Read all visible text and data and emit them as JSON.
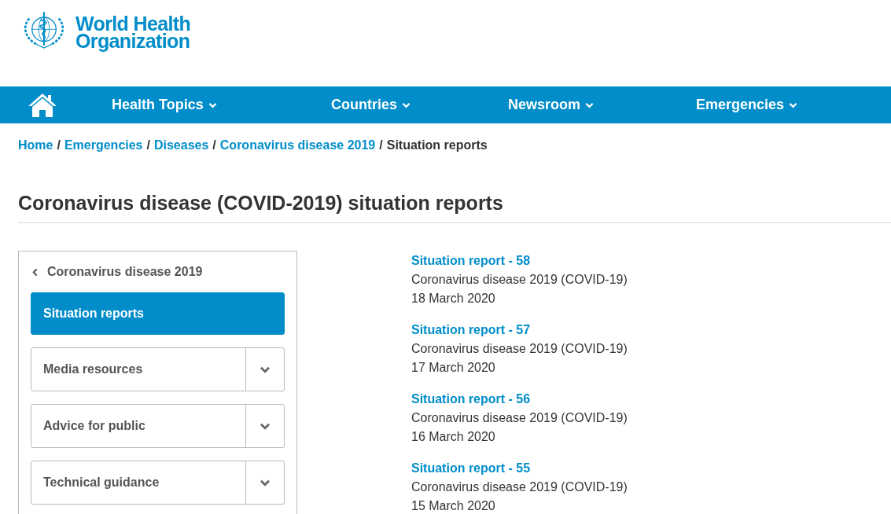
{
  "logo": {
    "lines": [
      "World Health",
      "Organization"
    ]
  },
  "nav": {
    "items": [
      {
        "label": "Health Topics"
      },
      {
        "label": "Countries"
      },
      {
        "label": "Newsroom"
      },
      {
        "label": "Emergencies"
      }
    ]
  },
  "breadcrumb": {
    "links": [
      "Home",
      "Emergencies",
      "Diseases",
      "Coronavirus disease 2019"
    ],
    "separator": "/",
    "current": "Situation reports"
  },
  "page_title": "Coronavirus disease (COVID-2019) situation reports",
  "sidebar": {
    "back": "Coronavirus disease 2019",
    "items": [
      {
        "label": "Situation reports",
        "kind": "link",
        "selected": true
      },
      {
        "label": "Media resources",
        "kind": "group",
        "selected": false,
        "expanded": false
      },
      {
        "label": "Advice for public",
        "kind": "group",
        "selected": false,
        "expanded": false
      },
      {
        "label": "Technical guidance",
        "kind": "group",
        "selected": false,
        "expanded": false
      }
    ]
  },
  "reports": [
    {
      "title": "Situation report - 58",
      "subtitle": "Coronavirus disease 2019 (COVID-19)",
      "date": "18 March 2020"
    },
    {
      "title": "Situation report - 57",
      "subtitle": "Coronavirus disease 2019 (COVID-19)",
      "date": "17 March 2020"
    },
    {
      "title": "Situation report - 56",
      "subtitle": "Coronavirus disease 2019 (COVID-19)",
      "date": "16 March 2020"
    },
    {
      "title": "Situation report - 55",
      "subtitle": "Coronavirus disease 2019 (COVID-19)",
      "date": "15 March 2020"
    }
  ]
}
